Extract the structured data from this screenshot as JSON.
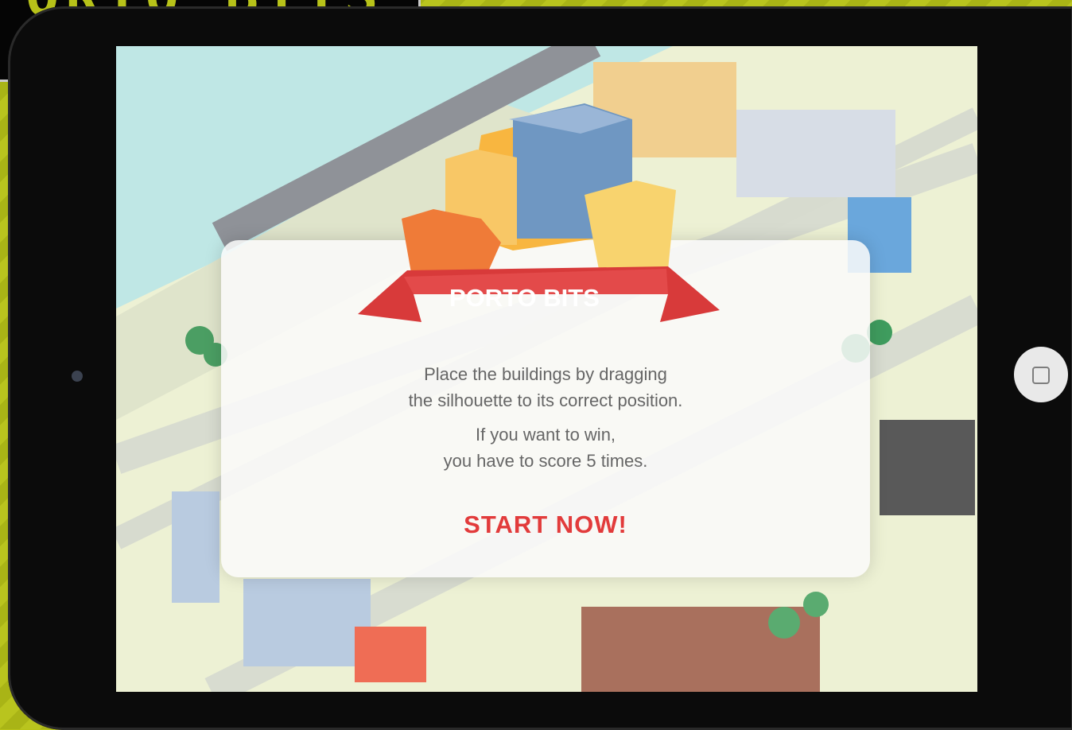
{
  "brand": {
    "game_title": "PORTO BITS",
    "corner_title": "PORTO BITS"
  },
  "dialog": {
    "instruction_line1": "Place the buildings by dragging",
    "instruction_line2": "the silhouette to its correct position.",
    "win_line1": "If you want to win,",
    "win_line2": "you have to score 5 times.",
    "start_label": "START NOW!"
  },
  "colors": {
    "accent_red": "#e23b3b",
    "background_green": "#b7c219"
  }
}
